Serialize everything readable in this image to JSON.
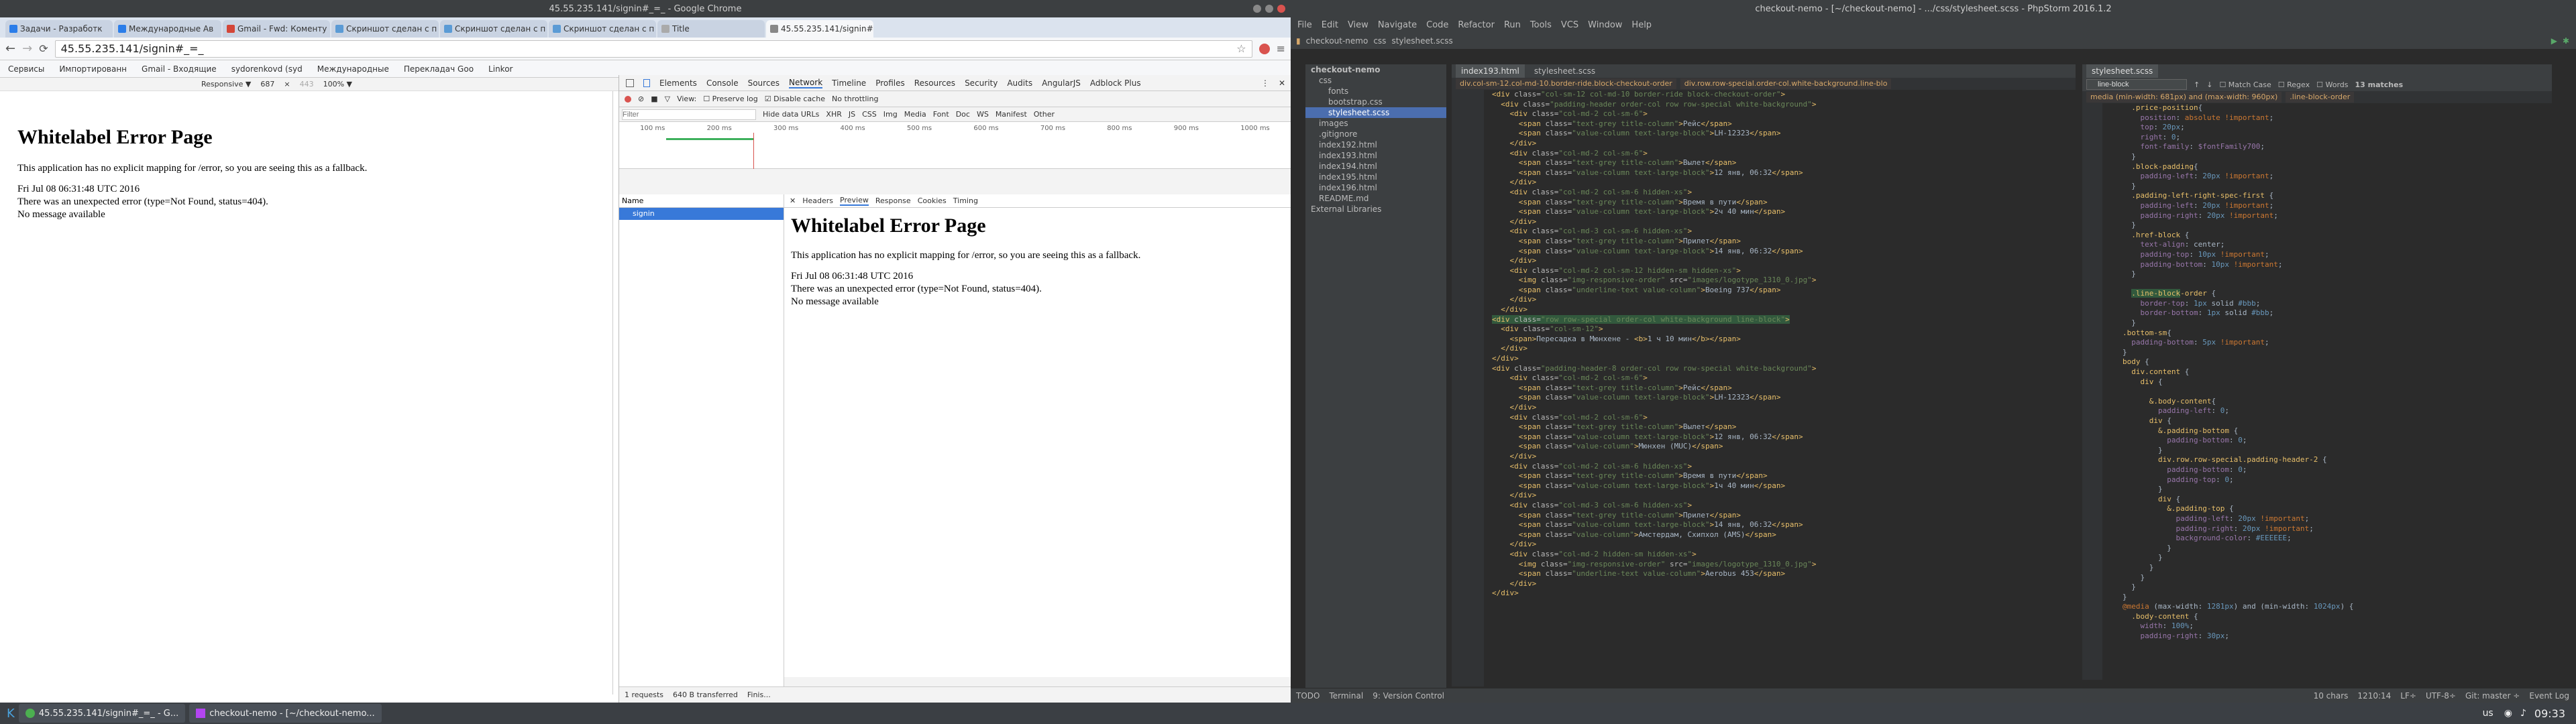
{
  "chrome": {
    "window_title": "45.55.235.141/signin#_=_ - Google Chrome",
    "tabs": [
      "Задачи - Разработк",
      "Международные Ав",
      "Gmail - Fwd: Коменту",
      "Скриншот сделан с п",
      "Скриншот сделан с п",
      "Скриншот сделан с п",
      "Title",
      "45.55.235.141/signin#"
    ],
    "url": "45.55.235.141/signin#_=_",
    "bookmarks": [
      "Сервисы",
      "Импортированн",
      "Gmail - Входящие",
      "sydorenkovd (syd",
      "Международные",
      "Перекладач Goo",
      "Linkor"
    ],
    "responsive": {
      "mode": "Responsive ▼",
      "width": "687",
      "x": "×",
      "height": "443",
      "zoom": "100% ▼"
    }
  },
  "page": {
    "title": "Whitelabel Error Page",
    "line1": "This application has no explicit mapping for /error, so you are seeing this as a fallback.",
    "date": "Fri Jul 08 06:31:48 UTC 2016",
    "error": "There was an unexpected error (type=Not Found, status=404).",
    "message": "No message available"
  },
  "devtools": {
    "tabs": [
      "Elements",
      "Console",
      "Sources",
      "Network",
      "Timeline",
      "Profiles",
      "Resources",
      "Security",
      "Audits",
      "AngularJS",
      "Adblock Plus"
    ],
    "toolbar": [
      "View:",
      "Preserve log",
      "Disable cache",
      "No throttling"
    ],
    "filter_placeholder": "Filter",
    "filters": [
      "Hide data URLs",
      "XHR",
      "JS",
      "CSS",
      "Img",
      "Media",
      "Font",
      "Doc",
      "WS",
      "Manifest",
      "Other"
    ],
    "ticks": [
      "100 ms",
      "200 ms",
      "300 ms",
      "400 ms",
      "500 ms",
      "600 ms",
      "700 ms",
      "800 ms",
      "900 ms",
      "1000 ms"
    ],
    "name_col": "Name",
    "request": "signin",
    "subtabs": [
      "Headers",
      "Preview",
      "Response",
      "Cookies",
      "Timing"
    ],
    "status": [
      "1 requests",
      "640 B transferred",
      "Finis..."
    ]
  },
  "ide": {
    "window_title": "checkout-nemo - [~/checkout-nemo] - .../css/stylesheet.scss - PhpStorm 2016.1.2",
    "menu": [
      "File",
      "Edit",
      "View",
      "Navigate",
      "Code",
      "Refactor",
      "Run",
      "Tools",
      "VCS",
      "Window",
      "Help"
    ],
    "breadcrumb": [
      "checkout-nemo",
      "css",
      "stylesheet.scss"
    ],
    "project": [
      "checkout-nemo",
      "css",
      "fonts",
      "bootstrap.css",
      "stylesheet.scss",
      "images",
      ".gitignore",
      "index192.html",
      "index193.html",
      "index194.html",
      "index195.html",
      "index196.html",
      "README.md",
      "External Libraries"
    ],
    "editor_tabs": [
      "index193.html",
      "stylesheet.scss"
    ],
    "crumbs": [
      "div.col-sm-12.col-md-10.border-ride.block-checkout-order",
      "div.row.row-special.order-col.white-background.line-blo"
    ],
    "search": {
      "query": "line-block",
      "options": [
        "Match Case",
        "Regex",
        "Words"
      ],
      "matches": "13 matches"
    },
    "scss_crumbs": [
      "media (min-width: 681px) and (max-width: 960px)",
      ".line-block-order"
    ],
    "status": [
      "10 chars",
      "1210:14",
      "LF÷",
      "UTF-8÷",
      "Git: master ÷"
    ],
    "bottom": [
      "TODO",
      "Terminal",
      "9: Version Control",
      "Event Log"
    ]
  },
  "taskbar": {
    "tasks": [
      "45.55.235.141/signin#_=_ - G...",
      "checkout-nemo - [~/checkout-nemo..."
    ],
    "lang": "us",
    "clock": "09:33"
  }
}
